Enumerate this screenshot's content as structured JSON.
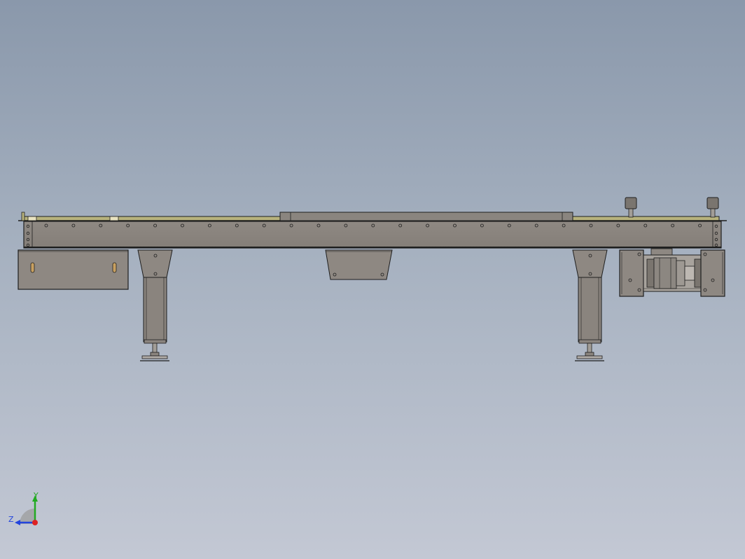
{
  "view": {
    "background_top": "#8a98ab",
    "background_bottom": "#c3c8d4",
    "part_fill": "#8e8882",
    "part_dark": "#6f6a65",
    "edge_color": "#1e1e1e",
    "rail_color": "#b7b27c"
  },
  "triad": {
    "y_label": "Y",
    "z_label": "Z",
    "y_color": "#22aa22",
    "z_color": "#2244dd",
    "x_color": "#dd2222"
  }
}
